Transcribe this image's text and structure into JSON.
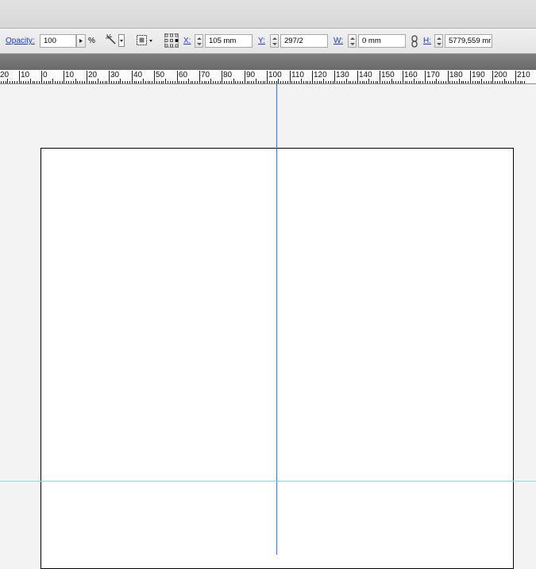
{
  "control_bar": {
    "opacity": {
      "label": "Opacity:",
      "value": "100",
      "unit": "%"
    },
    "x": {
      "label": "X:",
      "value": "105 mm"
    },
    "y": {
      "label": "Y:",
      "value": "297/2"
    },
    "w": {
      "label": "W:",
      "value": "0 mm"
    },
    "h": {
      "label": "H:",
      "value": "5779,559 mr"
    }
  },
  "ruler": {
    "unit": "mm",
    "labels": [
      "20",
      "10",
      "0",
      "10",
      "20",
      "30",
      "40",
      "50",
      "60",
      "70",
      "80",
      "90",
      "100",
      "110",
      "120",
      "130",
      "140",
      "150",
      "160",
      "170",
      "180",
      "190",
      "200",
      "210"
    ]
  },
  "icons": {
    "opacity_arrow": "triangle-right-icon",
    "magic_wand": "magic-wand-icon",
    "transform_box": "transform-box-icon",
    "reference_point": "reference-point-icon",
    "constrain": "chain-link-icon"
  },
  "colors": {
    "link_label": "#1a3ad6",
    "annotation": "#d94a3a",
    "vertical_guide": "#4a6cf0",
    "horizontal_guide": "#7fe3ea"
  }
}
